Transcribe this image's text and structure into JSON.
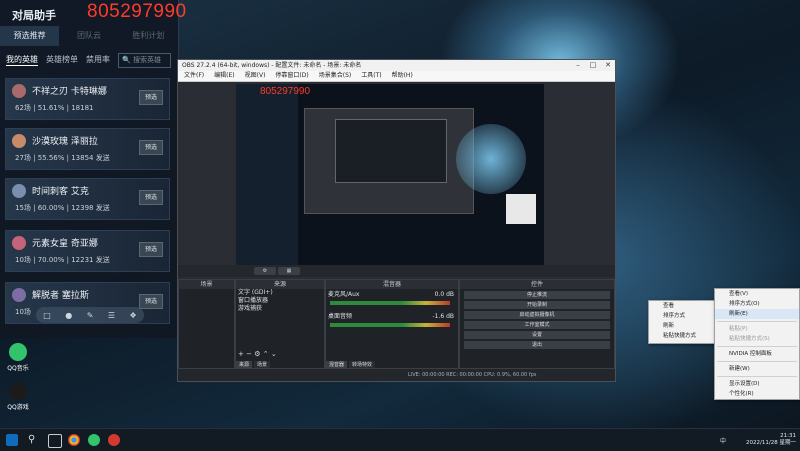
{
  "helper": {
    "title": "对局助手",
    "code": "805297990",
    "tabs": [
      "预选推荐",
      "团队云",
      "胜利计划"
    ],
    "sub_tabs": [
      "我的英雄",
      "英雄榜单",
      "禁用率"
    ],
    "search_placeholder": "搜索英雄",
    "heroes": [
      {
        "name": "不祥之刃 卡特琳娜",
        "stats": "62场 | 51.61% | 18181",
        "extra": "",
        "button": "预选",
        "color": "#b56a78"
      },
      {
        "name": "沙漠玫瑰 泽丽拉",
        "stats": "27场 | 55.56% | 13854",
        "extra": "发送",
        "button": "预选",
        "color": "#c78b6a"
      },
      {
        "name": "时间刺客 艾克",
        "stats": "15场 | 60.00% | 12398",
        "extra": "发送",
        "button": "预选",
        "color": "#7a8fb0"
      },
      {
        "name": "元素女皇 奇亚娜",
        "stats": "10场 | 70.00% | 12231",
        "extra": "发送",
        "button": "预选",
        "color": "#c4637a"
      },
      {
        "name": "解脱者 塞拉斯",
        "stats": "10场",
        "extra": "",
        "button": "预选",
        "color": "#7d6da2"
      }
    ],
    "toolbar_icons": [
      "chat-icon",
      "lock-icon",
      "edit-icon",
      "list-icon",
      "pin-icon"
    ]
  },
  "desktop_icons": [
    {
      "label": "QQ音乐",
      "color": "#32c36c"
    },
    {
      "label": "QQ游戏",
      "color": "#3a7bd5"
    }
  ],
  "obs": {
    "title": "OBS 27.2.4 (64-bit, windows) - 配置文件: 未命名 - 场景: 未命名",
    "menus": [
      "文件(F)",
      "编辑(E)",
      "视图(V)",
      "停靠窗口(D)",
      "场景集合(S)",
      "工具(T)",
      "帮助(H)"
    ],
    "preview_code": "805297990",
    "docks": {
      "scenes_title": "场景",
      "sources_title": "来源",
      "mixer_title": "混音器",
      "controls_title": "控件"
    },
    "sources": [
      "文字 (GDI+)",
      "窗口播放器",
      "游戏捕获"
    ],
    "mixer_channels": [
      {
        "name": "麦克风/Aux",
        "db": "0.0 dB"
      },
      {
        "name": "桌面音频",
        "db": "-1.6 dB"
      }
    ],
    "controls": [
      "停止推流",
      "开始录制",
      "启动虚拟摄像机",
      "工作室模式",
      "设置",
      "退出"
    ],
    "dock_tabs": [
      "来源",
      "场景"
    ],
    "mixer_tabs": [
      "混音器",
      "转场特效"
    ],
    "status": "LIVE: 00:00:00   REC: 00:00:00   CPU: 0.9%, 60.00 fps"
  },
  "context_menu_left": [
    "查看",
    "排序方式",
    "刷新",
    "粘贴快捷方式"
  ],
  "context_menu_main": [
    "查看(V)",
    "排序方式(O)",
    "刷新(E)",
    "粘贴(P)",
    "粘贴快捷方式(S)",
    "NVIDIA 控制面板",
    "新建(W)",
    "显示设置(D)",
    "个性化(R)"
  ],
  "taskbar": {
    "icons": [
      "start-icon",
      "search-icon",
      "task-view-icon",
      "chrome-icon",
      "qq-music-icon",
      "netease-icon"
    ],
    "time": "21:31",
    "date": "2022/11/28 星期一",
    "lang": "中"
  }
}
